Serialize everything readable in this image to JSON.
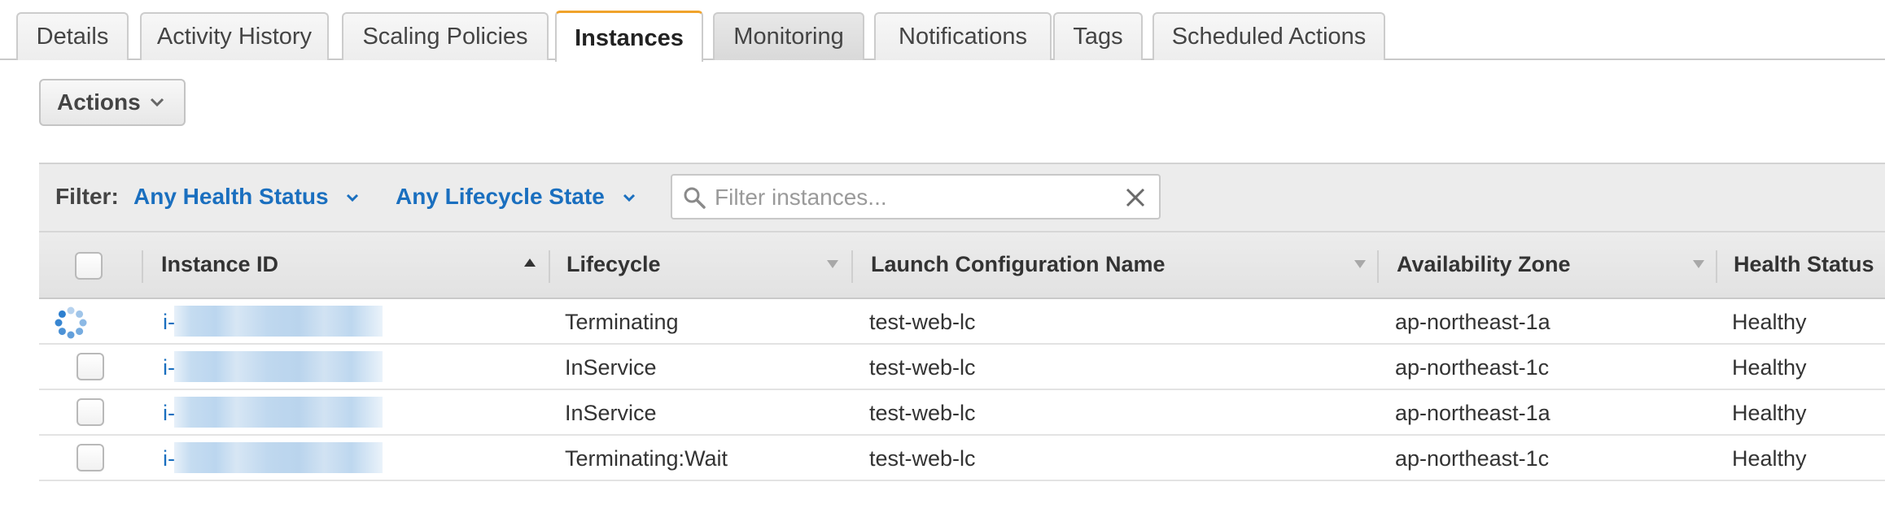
{
  "tabs": [
    {
      "label": "Details"
    },
    {
      "label": "Activity History"
    },
    {
      "label": "Scaling Policies"
    },
    {
      "label": "Instances",
      "active": true
    },
    {
      "label": "Monitoring"
    },
    {
      "label": "Notifications"
    },
    {
      "label": "Tags"
    },
    {
      "label": "Scheduled Actions"
    }
  ],
  "toolbar": {
    "actions_label": "Actions"
  },
  "filter": {
    "label": "Filter:",
    "health_status": "Any Health Status",
    "lifecycle_state": "Any Lifecycle State",
    "search_placeholder": "Filter instances...",
    "search_value": ""
  },
  "table": {
    "columns": {
      "instance_id": "Instance ID",
      "lifecycle": "Lifecycle",
      "launch_config": "Launch Configuration Name",
      "availability_zone": "Availability Zone",
      "health_status": "Health Status"
    },
    "rows": [
      {
        "id_prefix": "i-",
        "lifecycle": "Terminating",
        "launch_config": "test-web-lc",
        "availability_zone": "ap-northeast-1a",
        "health_status": "Healthy",
        "loading": true
      },
      {
        "id_prefix": "i-",
        "lifecycle": "InService",
        "launch_config": "test-web-lc",
        "availability_zone": "ap-northeast-1c",
        "health_status": "Healthy",
        "loading": false
      },
      {
        "id_prefix": "i-",
        "lifecycle": "InService",
        "launch_config": "test-web-lc",
        "availability_zone": "ap-northeast-1a",
        "health_status": "Healthy",
        "loading": false
      },
      {
        "id_prefix": "i-",
        "lifecycle": "Terminating:Wait",
        "launch_config": "test-web-lc",
        "availability_zone": "ap-northeast-1c",
        "health_status": "Healthy",
        "loading": false
      }
    ]
  },
  "icons": {
    "actions_chevron": "chevron-down-icon",
    "filter_chevron": "chevron-down-icon",
    "search": "search-icon",
    "clear": "close-icon",
    "sort_asc": "sort-ascending-icon",
    "sort_desc": "sort-descending-icon",
    "loading": "loading-spinner-icon"
  },
  "colors": {
    "link": "#1a6fbf",
    "active_tab_accent": "#f0a32b",
    "header_bg": "#ececec"
  }
}
